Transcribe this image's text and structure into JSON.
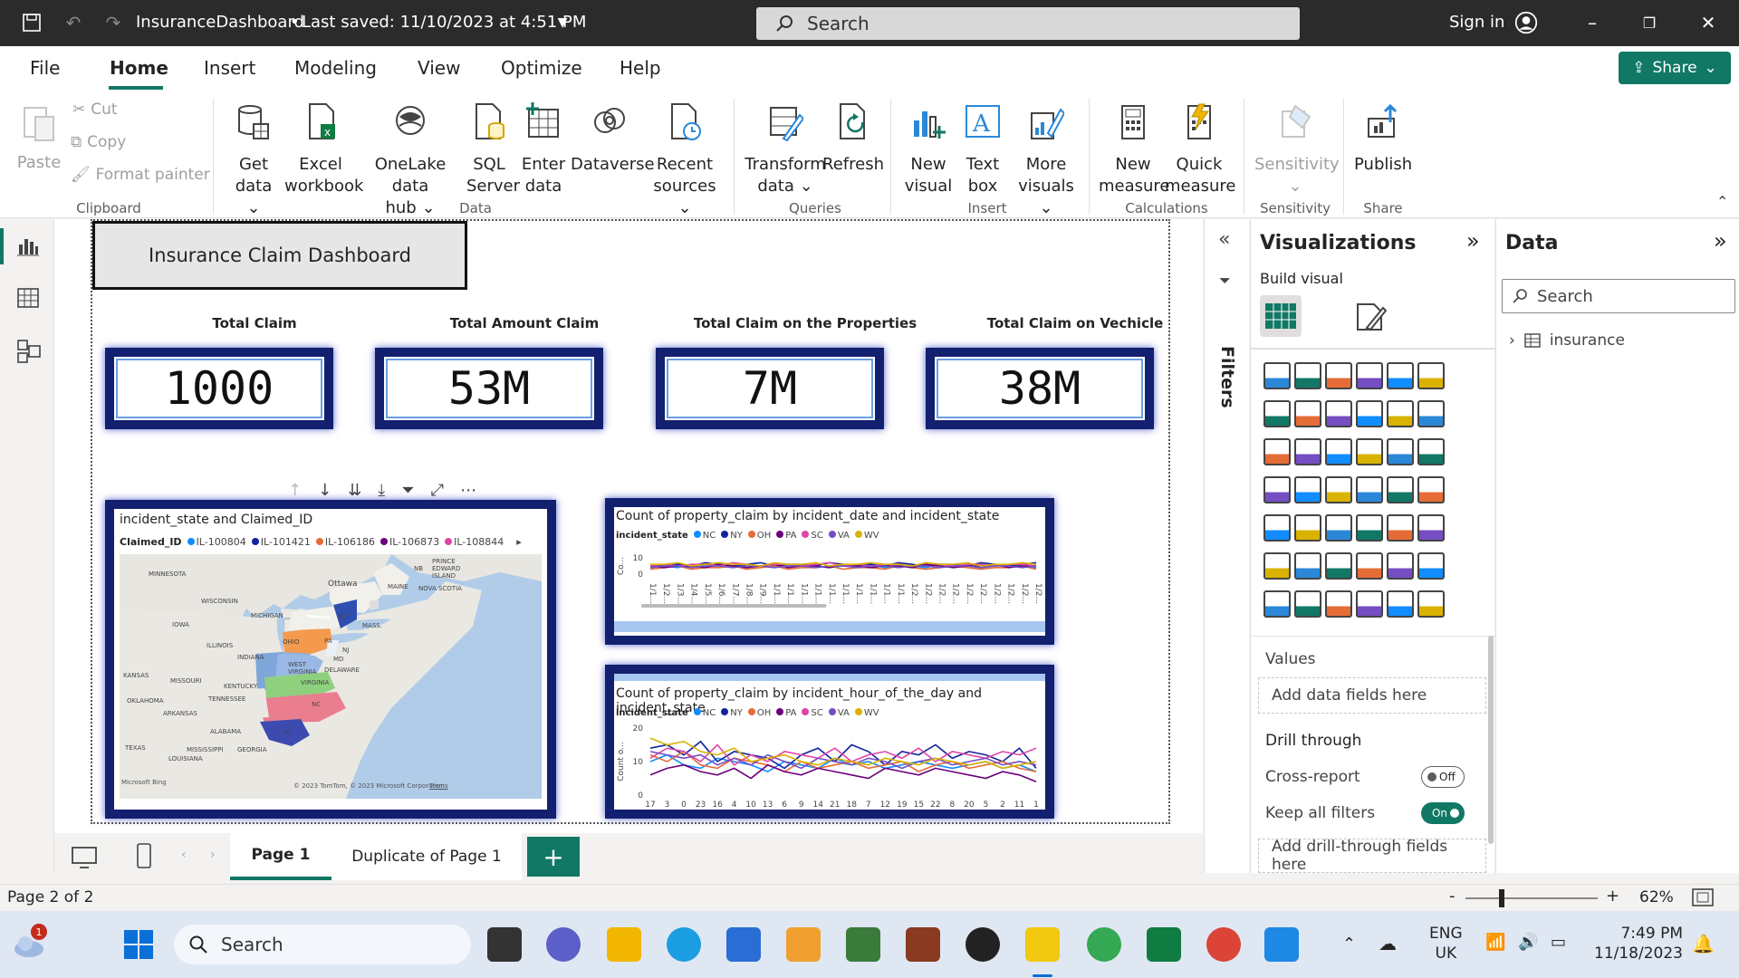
{
  "titlebar": {
    "file_title": "InsuranceDashboard",
    "saved": "Last saved: 11/10/2023 at 4:51 PM",
    "search_placeholder": "Search",
    "sign_in": "Sign in"
  },
  "menu": {
    "items": [
      "File",
      "Home",
      "Insert",
      "Modeling",
      "View",
      "Optimize",
      "Help"
    ],
    "share": "Share"
  },
  "ribbon": {
    "clipboard": {
      "paste": "Paste",
      "cut": "Cut",
      "copy": "Copy",
      "format_painter": "Format painter",
      "group": "Clipboard"
    },
    "data": {
      "get_data": [
        "Get",
        "data"
      ],
      "excel": [
        "Excel",
        "workbook"
      ],
      "onelake": [
        "OneLake data",
        "hub"
      ],
      "sql": [
        "SQL",
        "Server"
      ],
      "enter": [
        "Enter",
        "data"
      ],
      "dataverse": "Dataverse",
      "recent": [
        "Recent",
        "sources"
      ],
      "group": "Data"
    },
    "queries": {
      "transform": [
        "Transform",
        "data"
      ],
      "refresh": "Refresh",
      "group": "Queries"
    },
    "insert": {
      "new_visual": [
        "New",
        "visual"
      ],
      "text_box": [
        "Text",
        "box"
      ],
      "more_visuals": [
        "More",
        "visuals"
      ],
      "group": "Insert"
    },
    "calculations": {
      "new_measure": [
        "New",
        "measure"
      ],
      "quick_measure": [
        "Quick",
        "measure"
      ],
      "group": "Calculations"
    },
    "sensitivity": {
      "label": "Sensitivity",
      "group": "Sensitivity"
    },
    "share": {
      "publish": "Publish",
      "group": "Share"
    }
  },
  "report": {
    "title": "Insurance Claim Dashboard",
    "cards": [
      {
        "title": "Total Claim",
        "value": "1000"
      },
      {
        "title": "Total Amount Claim",
        "value": "53M"
      },
      {
        "title": "Total Claim on the Properties",
        "value": "7M"
      },
      {
        "title": "Total Claim on Vechicle",
        "value": "38M"
      }
    ],
    "map": {
      "title": "incident_state and Claimed_ID",
      "legend_label": "Claimed_ID",
      "legend": [
        {
          "name": "IL-100804",
          "color": "#118dff"
        },
        {
          "name": "IL-101421",
          "color": "#12239e"
        },
        {
          "name": "IL-106186",
          "color": "#e66c37"
        },
        {
          "name": "IL-106873",
          "color": "#6b007b"
        },
        {
          "name": "IL-108844",
          "color": "#e044a7"
        }
      ],
      "labels": [
        "MINNESOTA",
        "WISCONSIN",
        "MICHIGAN",
        "IOWA",
        "ILLINOIS",
        "INDIANA",
        "OHIO",
        "PA",
        "N.Y.",
        "MASS.",
        "MAINE",
        "NB",
        "PRINCE EDWARD ISLAND",
        "NOVA SCOTIA",
        "Ottawa",
        "KANSAS",
        "MISSOURI",
        "KENTUCKY",
        "WEST VIRGINIA",
        "VIRGINIA",
        "DELAWARE",
        "MD",
        "NJ",
        "OKLAHOMA",
        "TENNESSEE",
        "NC",
        "SC",
        "ARKANSAS",
        "ALABAMA",
        "MISSISSIPPI",
        "GEORGIA",
        "LOUISIANA",
        "TEXAS"
      ],
      "credit": "© 2023 TomTom, © 2023 Microsoft Corporation",
      "terms": "Terms",
      "bing": "Microsoft Bing"
    },
    "states": [
      "NC",
      "NY",
      "OH",
      "PA",
      "SC",
      "VA",
      "WV"
    ],
    "state_colors": [
      "#118dff",
      "#12239e",
      "#e66c37",
      "#6b007b",
      "#e044a7",
      "#744ec2",
      "#d9b300"
    ]
  },
  "chart_data": [
    {
      "type": "line",
      "title": "Count of property_claim by incident_date and incident_state",
      "legend_title": "incident_state",
      "ylabel": "Co...",
      "yticks": [
        "10",
        "0"
      ],
      "x": [
        "1/1...",
        "1/2...",
        "1/3...",
        "1/4...",
        "1/5...",
        "1/6...",
        "1/7...",
        "1/8...",
        "1/9...",
        "1/1...",
        "1/1...",
        "1/1...",
        "1/1...",
        "1/1...",
        "1/1...",
        "1/1...",
        "1/1...",
        "1/1...",
        "1/1...",
        "1/2...",
        "1/2...",
        "1/2...",
        "1/2...",
        "1/2...",
        "1/2...",
        "1/2...",
        "1/2...",
        "1/2...",
        "1/2..."
      ],
      "series": [
        {
          "name": "NC",
          "values": [
            4,
            5,
            4,
            6,
            5,
            5,
            4,
            6,
            5,
            4,
            5,
            6,
            5,
            4,
            5,
            5,
            6,
            4,
            5,
            5,
            4,
            6,
            5,
            5,
            4,
            5,
            6,
            5,
            4
          ]
        },
        {
          "name": "NY",
          "values": [
            6,
            5,
            6,
            5,
            7,
            6,
            5,
            6,
            7,
            5,
            6,
            6,
            5,
            7,
            6,
            5,
            6,
            5,
            7,
            6,
            5,
            6,
            6,
            5,
            7,
            6,
            5,
            6,
            7
          ]
        },
        {
          "name": "OH",
          "values": [
            3,
            4,
            5,
            3,
            4,
            4,
            5,
            3,
            4,
            5,
            3,
            4,
            4,
            5,
            3,
            4,
            4,
            3,
            5,
            4,
            3,
            4,
            5,
            4,
            3,
            4,
            4,
            5,
            3
          ]
        },
        {
          "name": "PA",
          "values": [
            5,
            4,
            5,
            5,
            4,
            6,
            5,
            4,
            5,
            6,
            4,
            5,
            5,
            4,
            6,
            5,
            4,
            5,
            5,
            4,
            6,
            5,
            4,
            5,
            5,
            6,
            4,
            5,
            5
          ]
        },
        {
          "name": "SC",
          "values": [
            5,
            6,
            5,
            6,
            6,
            5,
            7,
            6,
            5,
            6,
            6,
            5,
            6,
            7,
            5,
            6,
            5,
            6,
            6,
            5,
            7,
            6,
            5,
            6,
            6,
            5,
            6,
            6,
            5
          ]
        },
        {
          "name": "VA",
          "values": [
            4,
            5,
            5,
            4,
            5,
            5,
            4,
            5,
            5,
            4,
            5,
            5,
            4,
            5,
            5,
            4,
            5,
            5,
            4,
            5,
            5,
            4,
            5,
            5,
            4,
            5,
            5,
            4,
            5
          ]
        },
        {
          "name": "WV",
          "values": [
            6,
            6,
            7,
            5,
            6,
            7,
            6,
            6,
            5,
            7,
            6,
            6,
            7,
            5,
            6,
            6,
            7,
            6,
            6,
            5,
            7,
            6,
            6,
            7,
            5,
            6,
            6,
            7,
            6
          ]
        }
      ]
    },
    {
      "type": "line",
      "title": "Count of property_claim by incident_hour_of_the_day and incident_state",
      "legend_title": "incident_state",
      "ylabel": "Count o...",
      "yticks": [
        "20",
        "10",
        "0"
      ],
      "ylim": [
        0,
        20
      ],
      "x": [
        "17",
        "3",
        "0",
        "23",
        "16",
        "4",
        "10",
        "13",
        "6",
        "9",
        "14",
        "21",
        "18",
        "7",
        "12",
        "19",
        "15",
        "22",
        "8",
        "20",
        "5",
        "2",
        "11",
        "1"
      ],
      "series": [
        {
          "name": "NC",
          "values": [
            10,
            12,
            9,
            8,
            11,
            10,
            9,
            7,
            10,
            9,
            8,
            11,
            9,
            10,
            8,
            9,
            10,
            9,
            8,
            9,
            10,
            8,
            9,
            7
          ]
        },
        {
          "name": "NY",
          "values": [
            14,
            15,
            12,
            16,
            10,
            13,
            12,
            11,
            8,
            12,
            14,
            10,
            15,
            13,
            9,
            13,
            12,
            15,
            11,
            13,
            12,
            10,
            14,
            8
          ]
        },
        {
          "name": "OH",
          "values": [
            12,
            10,
            13,
            9,
            8,
            11,
            10,
            9,
            7,
            10,
            8,
            9,
            10,
            8,
            9,
            10,
            7,
            9,
            10,
            8,
            9,
            10,
            8,
            7
          ]
        },
        {
          "name": "PA",
          "values": [
            6,
            8,
            9,
            7,
            6,
            8,
            5,
            9,
            7,
            6,
            8,
            7,
            6,
            5,
            8,
            7,
            6,
            8,
            7,
            6,
            5,
            7,
            6,
            4
          ]
        },
        {
          "name": "SC",
          "values": [
            11,
            14,
            13,
            10,
            15,
            9,
            12,
            10,
            13,
            12,
            11,
            14,
            10,
            12,
            13,
            11,
            14,
            10,
            13,
            12,
            11,
            13,
            12,
            14
          ]
        },
        {
          "name": "VA",
          "values": [
            13,
            12,
            11,
            12,
            9,
            11,
            9,
            12,
            10,
            8,
            11,
            10,
            9,
            11,
            10,
            8,
            10,
            11,
            9,
            10,
            11,
            9,
            10,
            9
          ]
        },
        {
          "name": "WV",
          "values": [
            17,
            15,
            16,
            13,
            12,
            14,
            10,
            11,
            12,
            10,
            9,
            11,
            10,
            9,
            11,
            10,
            9,
            11,
            10,
            9,
            10,
            8,
            9,
            10
          ]
        }
      ]
    }
  ],
  "filters_label": "Filters",
  "viz_pane": {
    "title": "Visualizations",
    "build_visual": "Build visual",
    "values": "Values",
    "add_fields": "Add data fields here",
    "drill_through": "Drill through",
    "cross_report": "Cross-report",
    "cross_report_state": "Off",
    "keep_filters": "Keep all filters",
    "keep_filters_state": "On",
    "add_drill": "Add drill-through fields here"
  },
  "data_pane": {
    "title": "Data",
    "search_placeholder": "Search",
    "table": "insurance"
  },
  "pages": {
    "tabs": [
      "Page 1",
      "Duplicate of Page 1"
    ]
  },
  "status": {
    "page": "Page 2 of 2",
    "zoom": "62%"
  },
  "taskbar": {
    "search": "Search",
    "lang": "ENG",
    "region": "UK",
    "time": "7:49 PM",
    "date": "11/18/2023",
    "badge": "1"
  }
}
